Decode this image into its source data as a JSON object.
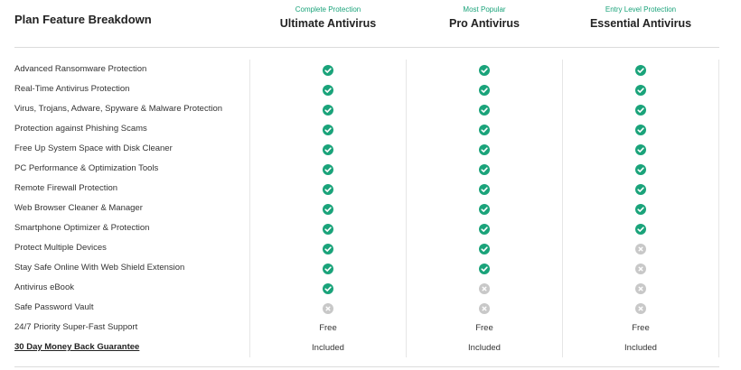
{
  "header": {
    "title": "Plan Feature Breakdown",
    "plans": [
      {
        "tag": "Complete Protection",
        "name": "Ultimate Antivirus"
      },
      {
        "tag": "Most Popular",
        "name": "Pro Antivirus"
      },
      {
        "tag": "Entry Level Protection",
        "name": "Essential Antivirus"
      }
    ]
  },
  "colors": {
    "accent": "#1aa37a",
    "check": "#1aa37a",
    "cross": "#c8c8c8"
  },
  "rows": [
    {
      "label": "Advanced Ransomware Protection",
      "cells": [
        "check-icon",
        "check-icon",
        "check-icon"
      ]
    },
    {
      "label": "Real-Time Antivirus Protection",
      "cells": [
        "check-icon",
        "check-icon",
        "check-icon"
      ]
    },
    {
      "label": "Virus, Trojans, Adware, Spyware & Malware Protection",
      "cells": [
        "check-icon",
        "check-icon",
        "check-icon"
      ]
    },
    {
      "label": "Protection against Phishing Scams",
      "cells": [
        "check-icon",
        "check-icon",
        "check-icon"
      ]
    },
    {
      "label": "Free Up System Space with Disk Cleaner",
      "cells": [
        "check-icon",
        "check-icon",
        "check-icon"
      ]
    },
    {
      "label": "PC Performance & Optimization Tools",
      "cells": [
        "check-icon",
        "check-icon",
        "check-icon"
      ]
    },
    {
      "label": "Remote Firewall Protection",
      "cells": [
        "check-icon",
        "check-icon",
        "check-icon"
      ]
    },
    {
      "label": "Web Browser Cleaner & Manager",
      "cells": [
        "check-icon",
        "check-icon",
        "check-icon"
      ]
    },
    {
      "label": "Smartphone Optimizer & Protection",
      "cells": [
        "check-icon",
        "check-icon",
        "check-icon"
      ]
    },
    {
      "label": "Protect Multiple Devices",
      "cells": [
        "check-icon",
        "check-icon",
        "cross-icon"
      ]
    },
    {
      "label": "Stay Safe Online With Web Shield Extension",
      "cells": [
        "check-icon",
        "check-icon",
        "cross-icon"
      ]
    },
    {
      "label": "Antivirus eBook",
      "cells": [
        "check-icon",
        "cross-icon",
        "cross-icon"
      ]
    },
    {
      "label": "Safe Password Vault",
      "cells": [
        "cross-icon",
        "cross-icon",
        "cross-icon"
      ]
    },
    {
      "label": "24/7 Priority Super-Fast Support",
      "cells": [
        "Free",
        "Free",
        "Free"
      ]
    },
    {
      "label": "30 Day Money Back Guarantee",
      "link": true,
      "cells": [
        "Included",
        "Included",
        "Included"
      ]
    }
  ]
}
